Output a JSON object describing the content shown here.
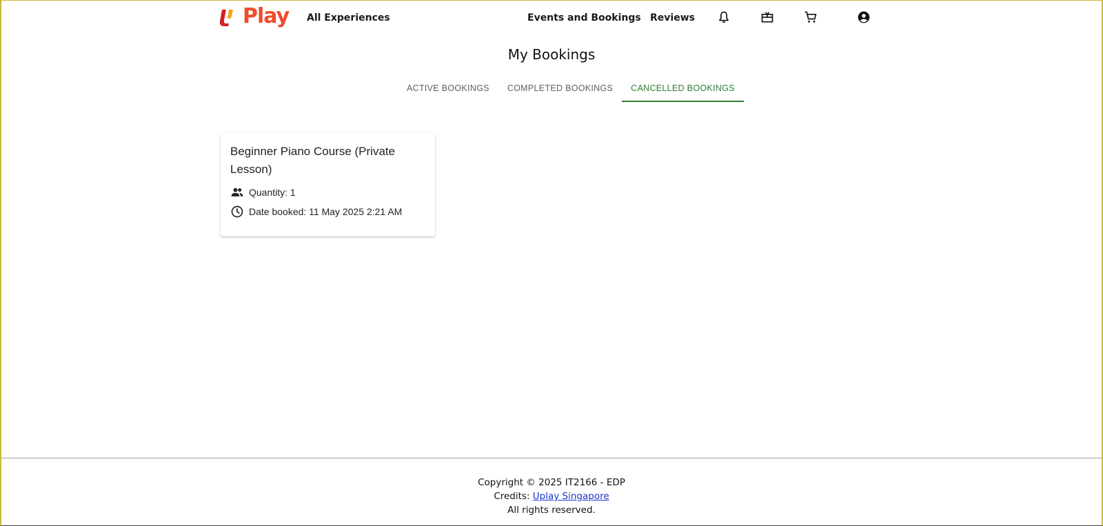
{
  "header": {
    "logo_text": "Play",
    "nav": {
      "all_experiences": "All Experiences",
      "events_and_bookings": "Events and Bookings",
      "reviews": "Reviews"
    },
    "icons": [
      "bell-icon",
      "gift-card-icon",
      "cart-icon",
      "account-circle-icon"
    ]
  },
  "page": {
    "title": "My Bookings",
    "tabs": [
      {
        "label": "Active Bookings",
        "active": false
      },
      {
        "label": "Completed Bookings",
        "active": false
      },
      {
        "label": "Cancelled Bookings",
        "active": true
      }
    ]
  },
  "bookings": [
    {
      "title": "Beginner Piano Course (Private Lesson)",
      "quantity_text": "Quantity: 1",
      "date_text": "Date booked: 11 May 2025 2:21 AM"
    }
  ],
  "footer": {
    "copyright": "Copyright © 2025 IT2166 - EDP",
    "credits_prefix": "Credits: ",
    "credits_link": "Uplay Singapore",
    "rights": "All rights reserved."
  },
  "colors": {
    "active_tab": "#2e7d32",
    "brand_orange": "#ef4b2c",
    "brand_red": "#d61f26",
    "brand_yellow": "#f7a21b",
    "link": "#1a33cc"
  }
}
